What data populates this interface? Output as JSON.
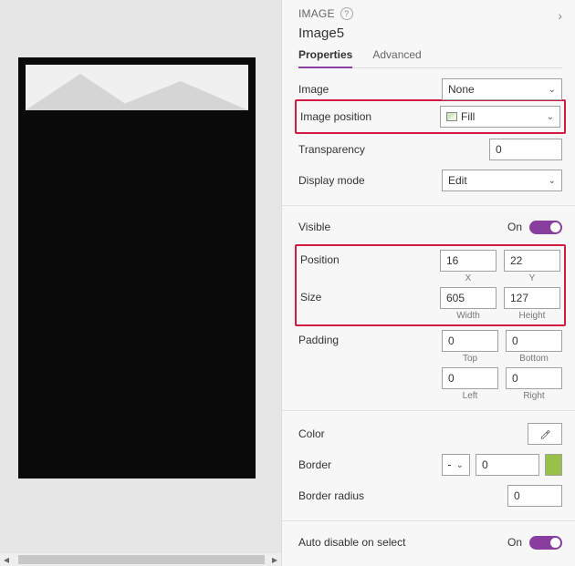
{
  "header": {
    "section": "IMAGE",
    "objectName": "Image5"
  },
  "tabs": {
    "properties": "Properties",
    "advanced": "Advanced"
  },
  "props": {
    "image": {
      "label": "Image",
      "value": "None"
    },
    "imagePosition": {
      "label": "Image position",
      "value": "Fill"
    },
    "transparency": {
      "label": "Transparency",
      "value": "0"
    },
    "displayMode": {
      "label": "Display mode",
      "value": "Edit"
    },
    "visible": {
      "label": "Visible",
      "state": "On"
    },
    "position": {
      "label": "Position",
      "x": {
        "value": "16",
        "caption": "X"
      },
      "y": {
        "value": "22",
        "caption": "Y"
      }
    },
    "size": {
      "label": "Size",
      "w": {
        "value": "605",
        "caption": "Width"
      },
      "h": {
        "value": "127",
        "caption": "Height"
      }
    },
    "padding": {
      "label": "Padding",
      "top": {
        "value": "0",
        "caption": "Top"
      },
      "bottom": {
        "value": "0",
        "caption": "Bottom"
      },
      "left": {
        "value": "0",
        "caption": "Left"
      },
      "right": {
        "value": "0",
        "caption": "Right"
      }
    },
    "color": {
      "label": "Color"
    },
    "border": {
      "label": "Border",
      "width": "0",
      "colorHex": "#99c14a"
    },
    "borderRadius": {
      "label": "Border radius",
      "value": "0"
    },
    "autoDisable": {
      "label": "Auto disable on select",
      "state": "On"
    }
  }
}
